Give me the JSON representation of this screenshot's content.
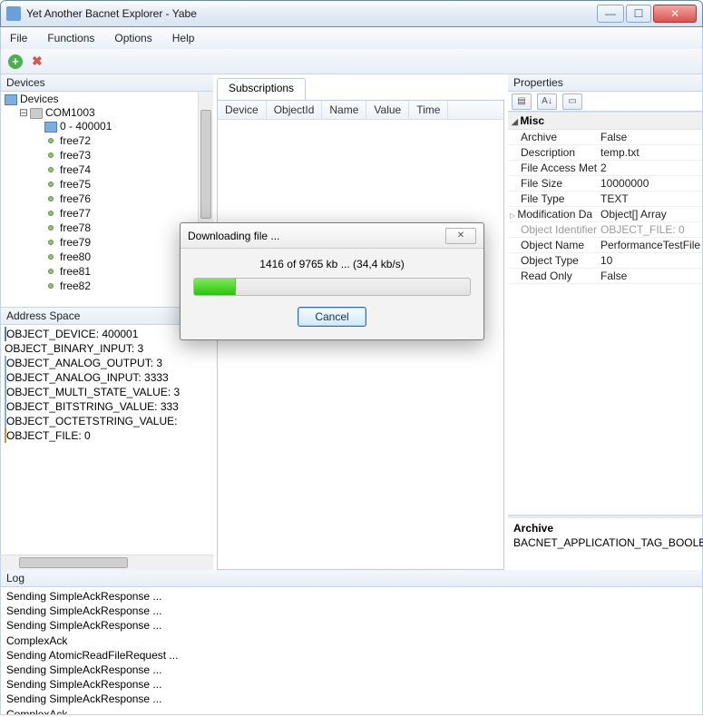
{
  "window": {
    "title": "Yet Another Bacnet Explorer - Yabe"
  },
  "menu": {
    "file": "File",
    "functions": "Functions",
    "options": "Options",
    "help": "Help"
  },
  "panes": {
    "devices": "Devices",
    "address_space": "Address Space",
    "subscriptions": "Subscriptions",
    "properties": "Properties",
    "log": "Log"
  },
  "devtree": {
    "root": "Devices",
    "port": "COM1003",
    "first": "0 - 400001",
    "free": [
      "free72",
      "free73",
      "free74",
      "free75",
      "free76",
      "free77",
      "free78",
      "free79",
      "free80",
      "free81",
      "free82"
    ]
  },
  "address_space": {
    "items": [
      {
        "icon": "dev",
        "label": "OBJECT_DEVICE: 400001"
      },
      {
        "icon": "bin",
        "label": "OBJECT_BINARY_INPUT: 3"
      },
      {
        "icon": "obj",
        "label": "OBJECT_ANALOG_OUTPUT: 3"
      },
      {
        "icon": "obj",
        "label": "OBJECT_ANALOG_INPUT: 3333"
      },
      {
        "icon": "obj",
        "label": "OBJECT_MULTI_STATE_VALUE: 3"
      },
      {
        "icon": "obj",
        "label": "OBJECT_BITSTRING_VALUE: 333"
      },
      {
        "icon": "obj",
        "label": "OBJECT_OCTETSTRING_VALUE:"
      },
      {
        "icon": "file",
        "label": "OBJECT_FILE: 0",
        "selected": true
      }
    ]
  },
  "subscriptions": {
    "cols": [
      "Device",
      "ObjectId",
      "Name",
      "Value",
      "Time"
    ]
  },
  "properties": {
    "category": "Misc",
    "rows": [
      {
        "k": "Archive",
        "v": "False"
      },
      {
        "k": "Description",
        "v": "temp.txt"
      },
      {
        "k": "File Access Met",
        "v": "2"
      },
      {
        "k": "File Size",
        "v": "10000000"
      },
      {
        "k": "File Type",
        "v": "TEXT"
      },
      {
        "k": "Modification Da",
        "v": "Object[] Array",
        "expand": true
      },
      {
        "k": "Object Identifier",
        "v": "OBJECT_FILE: 0",
        "disabled": true
      },
      {
        "k": "Object Name",
        "v": "PerformanceTestFile"
      },
      {
        "k": "Object Type",
        "v": "10"
      },
      {
        "k": "Read Only",
        "v": "False"
      }
    ],
    "desc_title": "Archive",
    "desc_body": "BACNET_APPLICATION_TAG_BOOLEAN"
  },
  "log": [
    "Sending SimpleAckResponse ...",
    "Sending SimpleAckResponse ...",
    "Sending SimpleAckResponse ...",
    "ComplexAck",
    "Sending AtomicReadFileRequest ...",
    "Sending SimpleAckResponse ...",
    "Sending SimpleAckResponse ...",
    "Sending SimpleAckResponse ...",
    "ComplexAck"
  ],
  "modal": {
    "title": "Downloading file ...",
    "status": "1416 of 9765 kb ... (34,4 kb/s)",
    "cancel": "Cancel"
  }
}
